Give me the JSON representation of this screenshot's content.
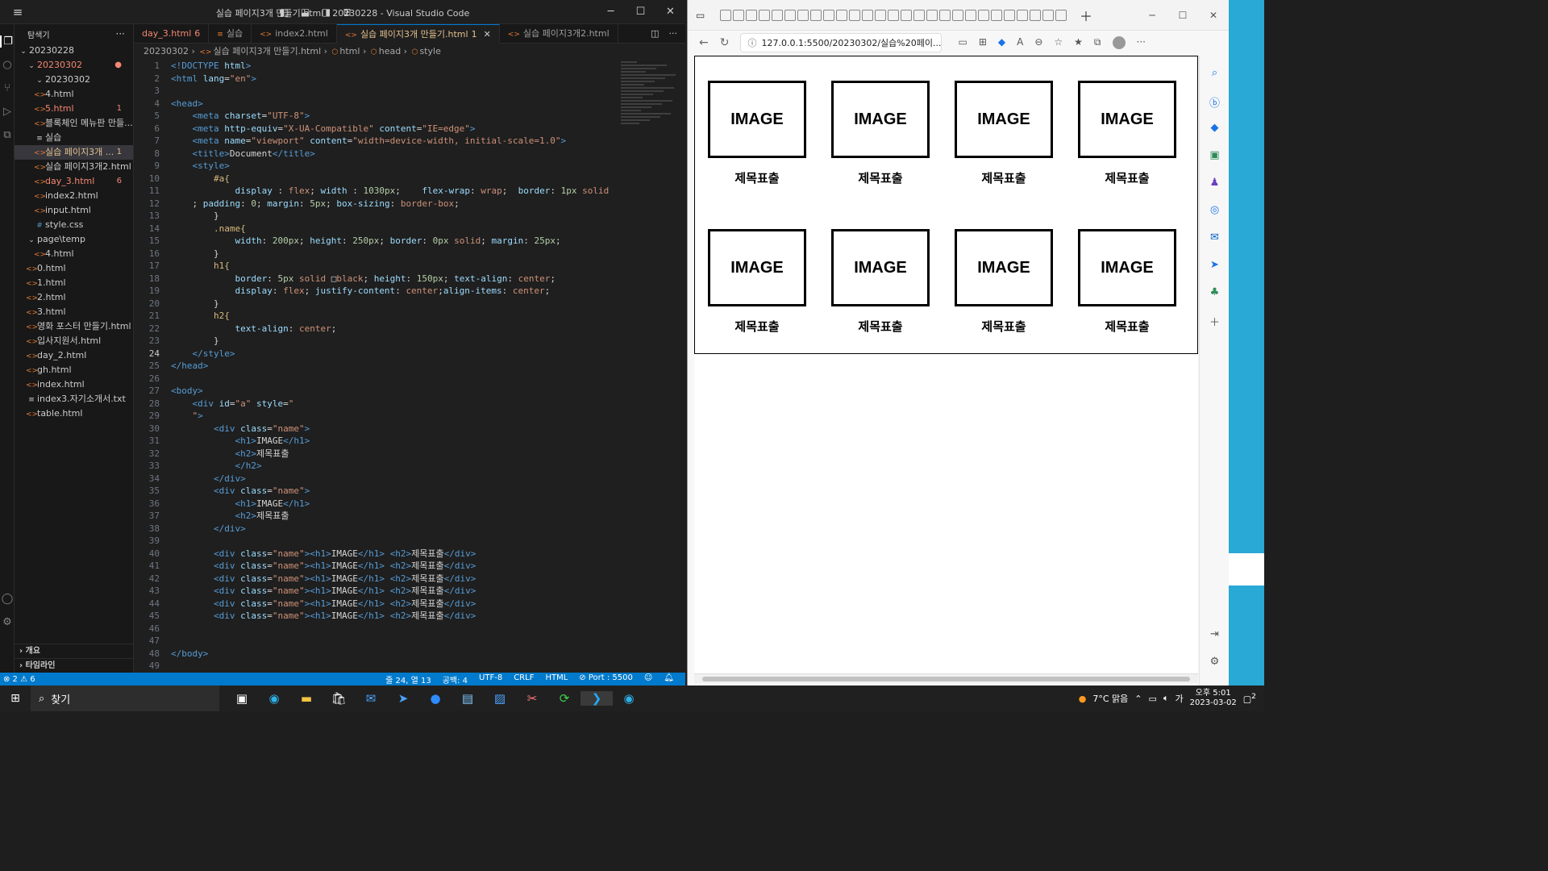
{
  "vscode": {
    "title": "실습 페이지3개 만들기.html - 20230228 - Visual Studio Code",
    "explorer_label": "탐색기",
    "tree": [
      {
        "label": "20230228",
        "indent": 0,
        "icon": "⌄",
        "cls": "c-gray",
        "badge": ""
      },
      {
        "label": "20230302",
        "indent": 1,
        "icon": "⌄",
        "cls": "c-red",
        "badge": "●"
      },
      {
        "label": "20230302",
        "indent": 2,
        "icon": "⌄",
        "cls": "c-gray",
        "badge": ""
      },
      {
        "label": "4.html",
        "indent": 2,
        "icon": "<>",
        "cls": "c-gray",
        "badge": ""
      },
      {
        "label": "5.html",
        "indent": 2,
        "icon": "<>",
        "cls": "c-red",
        "badge": "1"
      },
      {
        "label": "블록체인 메뉴판 만들...",
        "indent": 2,
        "icon": "<>",
        "cls": "c-gray",
        "badge": ""
      },
      {
        "label": "실습",
        "indent": 2,
        "icon": "≡",
        "cls": "c-gray",
        "badge": ""
      },
      {
        "label": "실습 페이지3개 ...",
        "indent": 2,
        "icon": "<>",
        "cls": "c-yellow",
        "badge": "1",
        "selected": true
      },
      {
        "label": "실습 페이지3개2.html",
        "indent": 2,
        "icon": "<>",
        "cls": "c-gray",
        "badge": ""
      },
      {
        "label": "day_3.html",
        "indent": 2,
        "icon": "<>",
        "cls": "c-red",
        "badge": "6"
      },
      {
        "label": "index2.html",
        "indent": 2,
        "icon": "<>",
        "cls": "c-gray",
        "badge": ""
      },
      {
        "label": "input.html",
        "indent": 2,
        "icon": "<>",
        "cls": "c-gray",
        "badge": ""
      },
      {
        "label": "style.css",
        "indent": 2,
        "icon": "#",
        "cls": "c-gray",
        "badge": ""
      },
      {
        "label": "page\\temp",
        "indent": 1,
        "icon": "⌄",
        "cls": "c-gray",
        "badge": ""
      },
      {
        "label": "4.html",
        "indent": 2,
        "icon": "<>",
        "cls": "c-gray",
        "badge": ""
      },
      {
        "label": "0.html",
        "indent": 1,
        "icon": "<>",
        "cls": "c-gray",
        "badge": ""
      },
      {
        "label": "1.html",
        "indent": 1,
        "icon": "<>",
        "cls": "c-gray",
        "badge": ""
      },
      {
        "label": "2.html",
        "indent": 1,
        "icon": "<>",
        "cls": "c-gray",
        "badge": ""
      },
      {
        "label": "3.html",
        "indent": 1,
        "icon": "<>",
        "cls": "c-gray",
        "badge": ""
      },
      {
        "label": "영화 포스터 만들기.html",
        "indent": 1,
        "icon": "<>",
        "cls": "c-gray",
        "badge": ""
      },
      {
        "label": "입사지원서.html",
        "indent": 1,
        "icon": "<>",
        "cls": "c-gray",
        "badge": ""
      },
      {
        "label": "day_2.html",
        "indent": 1,
        "icon": "<>",
        "cls": "c-gray",
        "badge": ""
      },
      {
        "label": "gh.html",
        "indent": 1,
        "icon": "<>",
        "cls": "c-gray",
        "badge": ""
      },
      {
        "label": "index.html",
        "indent": 1,
        "icon": "<>",
        "cls": "c-gray",
        "badge": ""
      },
      {
        "label": "index3.자기소개서.txt",
        "indent": 1,
        "icon": "≡",
        "cls": "c-gray",
        "badge": ""
      },
      {
        "label": "table.html",
        "indent": 1,
        "icon": "<>",
        "cls": "c-gray",
        "badge": ""
      }
    ],
    "outline_label": "개요",
    "timeline_label": "타임라인",
    "tabs": [
      {
        "label": "day_3.html",
        "count": "6",
        "icon": "",
        "active": false,
        "cls": "c-red"
      },
      {
        "label": "실습",
        "count": "",
        "icon": "≡",
        "active": false,
        "cls": ""
      },
      {
        "label": "index2.html",
        "count": "",
        "icon": "<>",
        "active": false,
        "cls": ""
      },
      {
        "label": "실습 페이지3개 만들기.html",
        "count": "1",
        "icon": "<>",
        "active": true,
        "cls": ""
      },
      {
        "label": "실습 페이지3개2.html",
        "count": "",
        "icon": "<>",
        "active": false,
        "cls": ""
      }
    ],
    "breadcrumb": [
      "20230302",
      "실습 페이지3개 만들기.html",
      "html",
      "head",
      "style"
    ],
    "current_line": 24,
    "code": [
      "<t>&lt;!DOCTYPE</t> <a>html</a><t>&gt;</t>",
      "<t>&lt;html</t> <a>lang</a>=<s>\"en\"</s><t>&gt;</t>",
      "",
      "<t>&lt;head&gt;</t>",
      "    <t>&lt;meta</t> <a>charset</a>=<s>\"UTF-8\"</s><t>&gt;</t>",
      "    <t>&lt;meta</t> <a>http-equiv</a>=<s>\"X-UA-Compatible\"</s> <a>content</a>=<s>\"IE=edge\"</s><t>&gt;</t>",
      "    <t>&lt;meta</t> <a>name</a>=<s>\"viewport\"</s> <a>content</a>=<s>\"width=device-width, initial-scale=1.0\"</s><t>&gt;</t>",
      "    <t>&lt;title&gt;</t>Document<t>&lt;/title&gt;</t>",
      "    <t>&lt;style&gt;</t>",
      "        <e>#a{</e>",
      "            <a>display</a> : <s>flex</s>; <a>width</a> : <n>1030px</n>;    <a>flex-wrap</a>: <s>wrap</s>;  <a>border</a>: <n>1px</n> <s>solid</s>",
      "    ; <a>padding</a>: <n>0</n>; <a>margin</a>: <n>5px</n>; <a>box-sizing</a>: <s>border-box</s>;",
      "        }",
      "        <e>.name{</e>",
      "            <a>width</a>: <n>200px</n>; <a>height</a>: <n>250px</n>; <a>border</a>: <n>0px</n> <s>solid</s>; <a>margin</a>: <n>25px</n>;",
      "        }",
      "        <e>h1{</e>",
      "            <a>border</a>: <n>5px</n> <s>solid</s> □<s>black</s>; <a>height</a>: <n>150px</n>; <a>text-align</a>: <s>center</s>;",
      "            <a>display</a>: <s>flex</s>; <a>justify-content</a>: <s>center</s>;<a>align-items</a>: <s>center</s>;",
      "        }",
      "        <e>h2{</e>",
      "            <a>text-align</a>: <s>center</s>;",
      "        }",
      "    <t>&lt;/style&gt;</t>",
      "<t>&lt;/head&gt;</t>",
      "",
      "<t>&lt;body&gt;</t>",
      "    <t>&lt;div</t> <a>id</a>=<s>\"a\"</s> <a>style</a>=<s>\"</s>",
      "    <s>\"</s><t>&gt;</t>",
      "        <t>&lt;div</t> <a>class</a>=<s>\"name\"</s><t>&gt;</t>",
      "            <t>&lt;h1&gt;</t>IMAGE<t>&lt;/h1&gt;</t>",
      "            <t>&lt;h2&gt;</t>제목표출",
      "            <t>&lt;/h2&gt;</t>",
      "        <t>&lt;/div&gt;</t>",
      "        <t>&lt;div</t> <a>class</a>=<s>\"name\"</s><t>&gt;</t>",
      "            <t>&lt;h1&gt;</t>IMAGE<t>&lt;/h1&gt;</t>",
      "            <t>&lt;h2&gt;</t>제목표출",
      "        <t>&lt;/div&gt;</t>",
      "",
      "        <t>&lt;div</t> <a>class</a>=<s>\"name\"</s><t>&gt;&lt;h1&gt;</t>IMAGE<t>&lt;/h1&gt;</t> <t>&lt;h2&gt;</t>제목표출<t>&lt;/div&gt;</t>",
      "        <t>&lt;div</t> <a>class</a>=<s>\"name\"</s><t>&gt;&lt;h1&gt;</t>IMAGE<t>&lt;/h1&gt;</t> <t>&lt;h2&gt;</t>제목표출<t>&lt;/div&gt;</t>",
      "        <t>&lt;div</t> <a>class</a>=<s>\"name\"</s><t>&gt;&lt;h1&gt;</t>IMAGE<t>&lt;/h1&gt;</t> <t>&lt;h2&gt;</t>제목표출<t>&lt;/div&gt;</t>",
      "        <t>&lt;div</t> <a>class</a>=<s>\"name\"</s><t>&gt;&lt;h1&gt;</t>IMAGE<t>&lt;/h1&gt;</t> <t>&lt;h2&gt;</t>제목표출<t>&lt;/div&gt;</t>",
      "        <t>&lt;div</t> <a>class</a>=<s>\"name\"</s><t>&gt;&lt;h1&gt;</t>IMAGE<t>&lt;/h1&gt;</t> <t>&lt;h2&gt;</t>제목표출<t>&lt;/div&gt;</t>",
      "        <t>&lt;div</t> <a>class</a>=<s>\"name\"</s><t>&gt;&lt;h1&gt;</t>IMAGE<t>&lt;/h1&gt;</t> <t>&lt;h2&gt;</t>제목표출<t>&lt;/div&gt;</t>",
      "",
      "",
      "<t>&lt;/body&gt;</t>",
      ""
    ],
    "status": {
      "problems": "⊗ 2 ⚠ 6",
      "position": "줄 24, 열 13",
      "spaces": "공백: 4",
      "encoding": "UTF-8",
      "eol": "CRLF",
      "language": "HTML",
      "port": "⊘ Port : 5500"
    }
  },
  "edge": {
    "url": "127.0.0.1:5500/20230302/실습%20페이...",
    "page": {
      "cards": [
        {
          "image": "IMAGE",
          "title": "제목표출"
        },
        {
          "image": "IMAGE",
          "title": "제목표출"
        },
        {
          "image": "IMAGE",
          "title": "제목표출"
        },
        {
          "image": "IMAGE",
          "title": "제목표출"
        },
        {
          "image": "IMAGE",
          "title": "제목표출"
        },
        {
          "image": "IMAGE",
          "title": "제목표출"
        },
        {
          "image": "IMAGE",
          "title": "제목표출"
        },
        {
          "image": "IMAGE",
          "title": "제목표출"
        }
      ]
    }
  },
  "taskbar": {
    "search_label": "찾기",
    "weather": "7°C  맑음",
    "ime": "가",
    "time": "오후 5:01",
    "date": "2023-03-02",
    "notifications": "2"
  },
  "colors": {
    "statusbar": "#007acc",
    "accent": "#0078d4"
  }
}
